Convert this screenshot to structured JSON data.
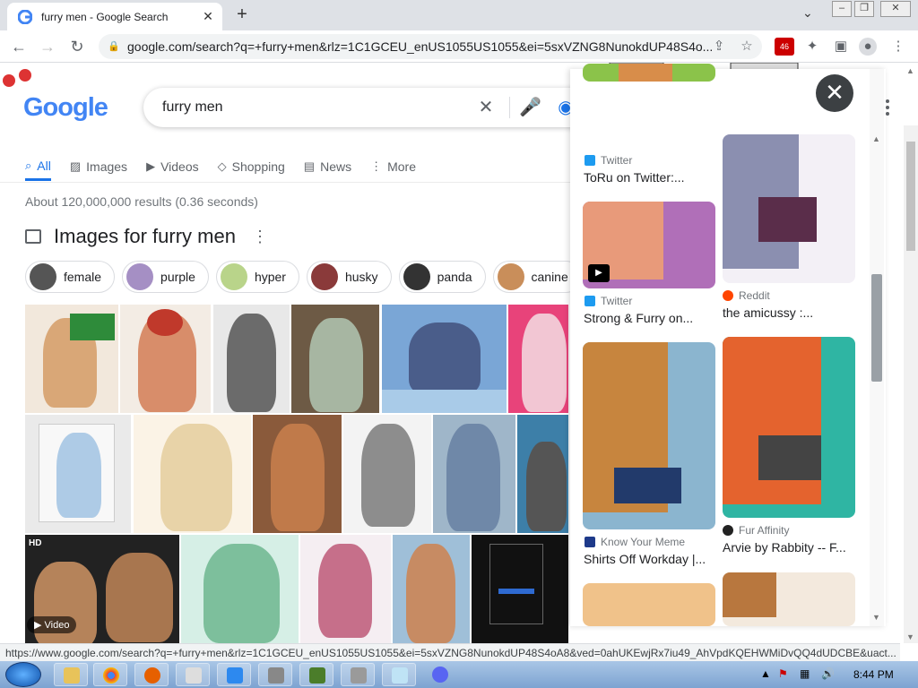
{
  "browser": {
    "tab_title": "furry men - Google Search",
    "url": "google.com/search?q=+furry+men&rlz=1C1GCEU_enUS1055US1055&ei=5sxVZNG8NunokdUP48S4o...",
    "extension_badge": "46",
    "status_url": "https://www.google.com/search?q=+furry+men&rlz=1C1GCEU_enUS1055US1055&ei=5sxVZNG8NunokdUP48S4oA8&ved=0ahUKEwjRx7iu49_AhVpdKQEHWMiDvQQ4dUDCBE&uact..."
  },
  "search": {
    "logo": "Google",
    "query": "furry men",
    "tabs": [
      {
        "label": "All",
        "icon": "search-icon",
        "active": true
      },
      {
        "label": "Images",
        "icon": "image-icon"
      },
      {
        "label": "Videos",
        "icon": "play-icon"
      },
      {
        "label": "Shopping",
        "icon": "tag-icon"
      },
      {
        "label": "News",
        "icon": "news-icon"
      },
      {
        "label": "More",
        "icon": "more-vert-icon"
      }
    ],
    "stats": "About 120,000,000 results (0.36 seconds)",
    "images_heading": "Images for furry men",
    "chips": [
      "female",
      "purple",
      "hyper",
      "husky",
      "panda",
      "canine"
    ],
    "video_badge": "Video"
  },
  "panel": {
    "items": [
      {
        "source": "Twitter",
        "title": "ToRu on Twitter:..."
      },
      {
        "source": "Twitter",
        "title": "Strong & Furry on..."
      },
      {
        "source": "Reddit",
        "title": "the amicussy :..."
      },
      {
        "source": "Know Your Meme",
        "title": "Shirts Off Workday |..."
      },
      {
        "source": "Fur Affinity",
        "title": "Arvie by Rabbity -- F..."
      }
    ]
  },
  "taskbar": {
    "time": "8:44 PM"
  },
  "colors": {
    "accent": "#1a73e8",
    "twitter": "#1d9bf0",
    "reddit": "#ff4500"
  }
}
